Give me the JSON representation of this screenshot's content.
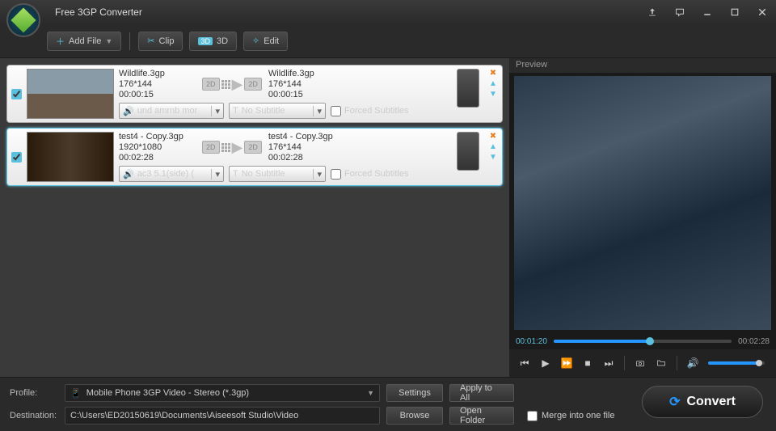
{
  "app": {
    "title": "Free 3GP Converter"
  },
  "toolbar": {
    "add": "Add File",
    "clip": "Clip",
    "threed": "3D",
    "edit": "Edit"
  },
  "items": [
    {
      "checked": true,
      "src": {
        "name": "Wildlife.3gp",
        "res": "176*144",
        "dur": "00:00:15"
      },
      "dst": {
        "name": "Wildlife.3gp",
        "res": "176*144",
        "dur": "00:00:15"
      },
      "audio": "und amrnb mor",
      "subtitle": "No Subtitle",
      "forced": "Forced Subtitles"
    },
    {
      "checked": true,
      "src": {
        "name": "test4 - Copy.3gp",
        "res": "1920*1080",
        "dur": "00:02:28"
      },
      "dst": {
        "name": "test4 - Copy.3gp",
        "res": "176*144",
        "dur": "00:02:28"
      },
      "audio": "ac3 5.1(side) (",
      "subtitle": "No Subtitle",
      "forced": "Forced Subtitles"
    }
  ],
  "badge2d": "2D",
  "preview": {
    "label": "Preview",
    "current": "00:01:20",
    "total": "00:02:28",
    "progress": 54
  },
  "bottom": {
    "profile_label": "Profile:",
    "profile": "Mobile Phone 3GP Video - Stereo (*.3gp)",
    "settings": "Settings",
    "apply": "Apply to All",
    "dest_label": "Destination:",
    "dest": "C:\\Users\\ED20150619\\Documents\\Aiseesoft Studio\\Video",
    "browse": "Browse",
    "open": "Open Folder",
    "merge": "Merge into one file"
  },
  "convert": "Convert"
}
